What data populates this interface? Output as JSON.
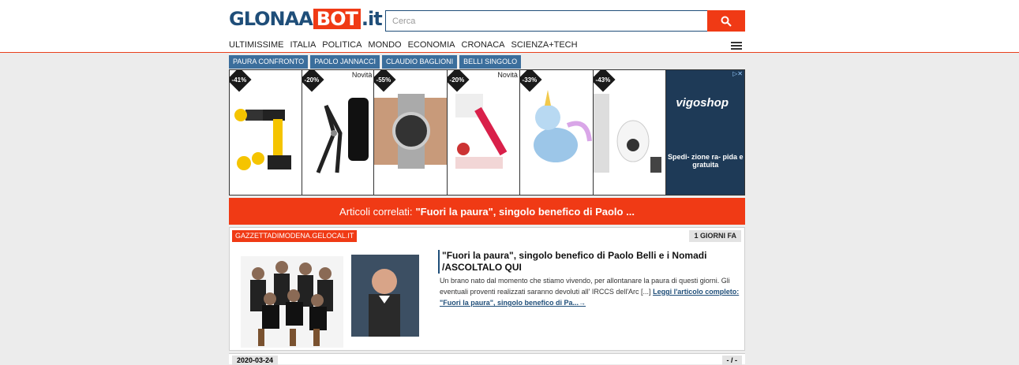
{
  "header": {
    "logo_part1": "GLONAA",
    "logo_part2": "BOT",
    "logo_part3": ".it",
    "search_placeholder": "Cerca"
  },
  "nav": {
    "items": [
      "ULTIMISSIME",
      "ITALIA",
      "POLITICA",
      "MONDO",
      "ECONOMIA",
      "CRONACA",
      "SCIENZA+TECH"
    ]
  },
  "tags": [
    "PAURA CONFRONTO",
    "PAOLO JANNACCI",
    "CLAUDIO BAGLIONI",
    "BELLI SINGOLO"
  ],
  "ads": {
    "products": [
      {
        "discount": "-41%",
        "novita": ""
      },
      {
        "discount": "-20%",
        "novita": "Novità"
      },
      {
        "discount": "-55%",
        "novita": ""
      },
      {
        "discount": "-20%",
        "novita": "Novità"
      },
      {
        "discount": "-33%",
        "novita": ""
      },
      {
        "discount": "-43%",
        "novita": ""
      }
    ],
    "brand": "vigoshop",
    "shipping": "Spedi- zione ra- pida e gratuita"
  },
  "related": {
    "prefix": "Articoli correlati:",
    "title": "\"Fuori la paura\", singolo benefico di Paolo ..."
  },
  "article": {
    "source": "GAZZETTADIMODENA.GELOCAL.IT",
    "ago": "1 GIORNI FA",
    "title": "\"Fuori la paura\", singolo benefico di Paolo Belli e i Nomadi /ASCOLTALO QUI",
    "summary": "Un brano nato dal momento che stiamo vivendo, per allontanare la paura di questi giorni. Gli eventuali proventi realizzati saranno devoluti all' IRCCS dell'Arc [...]",
    "read_more": "Leggi l'articolo completo: \"Fuori la paura\", singolo benefico di Pa...→"
  },
  "footer": {
    "date": "2020-03-24",
    "pager": "- / -"
  }
}
